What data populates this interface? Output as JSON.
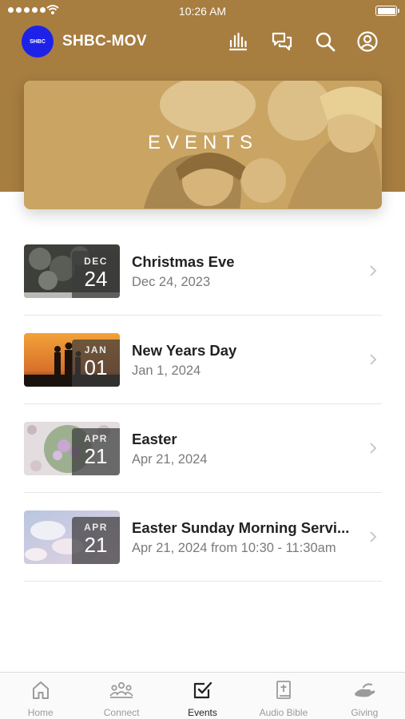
{
  "status_bar": {
    "time": "10:26 AM"
  },
  "header": {
    "logo_text": "SHBC",
    "title": "SHBC-MOV",
    "icons": [
      "bars-chart-icon",
      "chat-bubbles-icon",
      "search-icon",
      "profile-icon"
    ]
  },
  "banner": {
    "title": "EVENTS"
  },
  "events": [
    {
      "month": "DEC",
      "day": "24",
      "title": "Christmas Eve",
      "date": "Dec 24, 2023"
    },
    {
      "month": "JAN",
      "day": "01",
      "title": "New Years Day",
      "date": "Jan 1, 2024"
    },
    {
      "month": "APR",
      "day": "21",
      "title": "Easter",
      "date": "Apr 21, 2024"
    },
    {
      "month": "APR",
      "day": "21",
      "title": "Easter Sunday Morning Servi...",
      "date": "Apr 21, 2024 from 10:30 - 11:30am"
    }
  ],
  "tabs": [
    {
      "label": "Home",
      "icon": "home-icon",
      "active": false
    },
    {
      "label": "Connect",
      "icon": "people-icon",
      "active": false
    },
    {
      "label": "Events",
      "icon": "checkbox-icon",
      "active": true
    },
    {
      "label": "Audio Bible",
      "icon": "bible-icon",
      "active": false
    },
    {
      "label": "Giving",
      "icon": "giving-hand-icon",
      "active": false
    }
  ],
  "colors": {
    "header_bg": "#a77d40",
    "logo_bg": "#1e22e8",
    "active_tab": "#222222",
    "inactive_tab": "#9b9b9b"
  }
}
